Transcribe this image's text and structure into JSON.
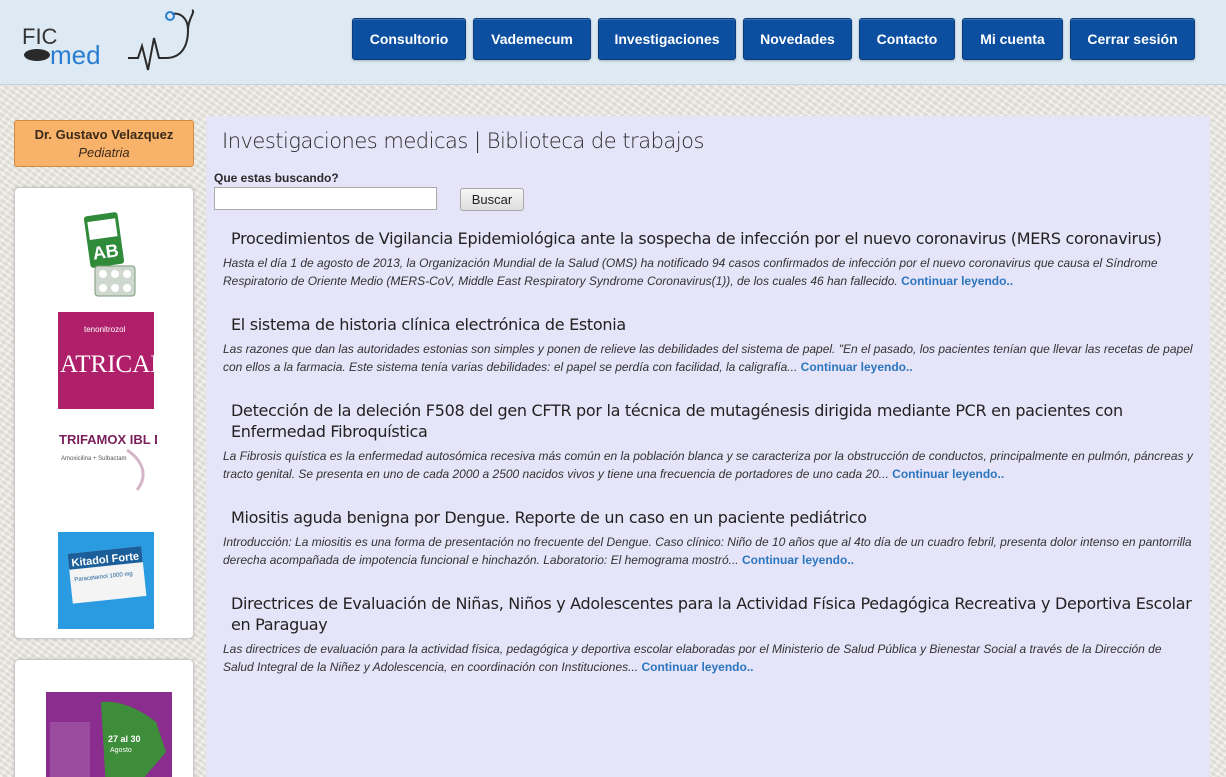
{
  "header": {
    "logo_text": "FIC",
    "logo_subtext": "med",
    "nav": [
      {
        "label": "Consultorio"
      },
      {
        "label": "Vademecum"
      },
      {
        "label": "Investigaciones"
      },
      {
        "label": "Novedades"
      },
      {
        "label": "Contacto"
      },
      {
        "label": "Mi cuenta"
      },
      {
        "label": "Cerrar sesión"
      }
    ]
  },
  "sidebar": {
    "doctor_name": "Dr. Gustavo Velazquez",
    "doctor_specialty": "Pediatria",
    "ads": [
      {
        "brand": "AB",
        "icon": "pill-pack-icon"
      },
      {
        "brand": "ATRICAN",
        "top": "tenonitrozol",
        "color": "#b0206a"
      },
      {
        "brand": "TRIFAMOX IBL DUO",
        "sub": "Amoxicilina + Sulbactam",
        "color": "#7a1f5a"
      },
      {
        "brand": "Kitadol Forte",
        "sub": "Paracetamol 1000 mg",
        "color": "#2a8fd0"
      }
    ],
    "ad_event": {
      "line1": "27 al 30",
      "line2": "Agosto",
      "color": "#8b2d8e"
    }
  },
  "main": {
    "title": "Investigaciones medicas | Biblioteca de trabajos",
    "search": {
      "label": "Que estas buscando?",
      "value": "",
      "placeholder": "",
      "button_label": "Buscar"
    },
    "read_more_label": "Continuar leyendo..",
    "articles": [
      {
        "title": "Procedimientos de Vigilancia Epidemiológica ante la sospecha de infección por el nuevo coronavirus (MERS coronavirus)",
        "summary": "Hasta el día 1 de agosto de 2013, la Organización Mundial de la Salud (OMS) ha notificado 94 casos confirmados de infección por el nuevo coronavirus que causa el Síndrome Respiratorio de Oriente Medio (MERS-CoV, Middle East Respiratory Syndrome Coronavirus(1)), de los cuales 46 han fallecido."
      },
      {
        "title": "El sistema de historia clínica electrónica de Estonia",
        "summary": "Las razones que dan las autoridades estonias son simples y ponen de relieve las debilidades del sistema de papel. \"En el pasado, los pacientes tenían que llevar las recetas de papel con ellos a la farmacia. Este sistema tenía varias debilidades: el papel se perdía con facilidad, la caligrafía..."
      },
      {
        "title": "Detección de la deleción F508 del gen CFTR por la técnica de mutagénesis dirigida mediante PCR en pacientes con Enfermedad Fibroquística",
        "summary": "La Fibrosis quística es la enfermedad autosómica recesiva más común en la población blanca y se caracteriza por la obstrucción de conductos, principalmente en pulmón, páncreas y tracto genital. Se presenta en uno de cada 2000 a 2500 nacidos vivos y tiene una frecuencia de portadores de uno cada 20..."
      },
      {
        "title": "Miositis aguda benigna por Dengue. Reporte de un caso en un paciente pediátrico",
        "summary": "Introducción: La miositis es una forma de presentación no frecuente del Dengue. Caso clínico: Niño de 10 años que al 4to día de un cuadro febril, presenta dolor intenso en pantorrilla derecha acompañada de impotencia funcional e hinchazón. Laboratorio: El hemograma mostró..."
      },
      {
        "title": "Directrices de Evaluación de Niñas, Niños y Adolescentes para la Actividad Física Pedagógica Recreativa y Deportiva Escolar en Paraguay",
        "summary": "Las directrices de evaluación para la actividad física, pedagógica y deportiva escolar elaboradas por el Ministerio de Salud Pública y Bienestar Social a través de la Dirección de Salud Integral de la Niñez y Adolescencia, en coordinación con Instituciones..."
      }
    ]
  }
}
